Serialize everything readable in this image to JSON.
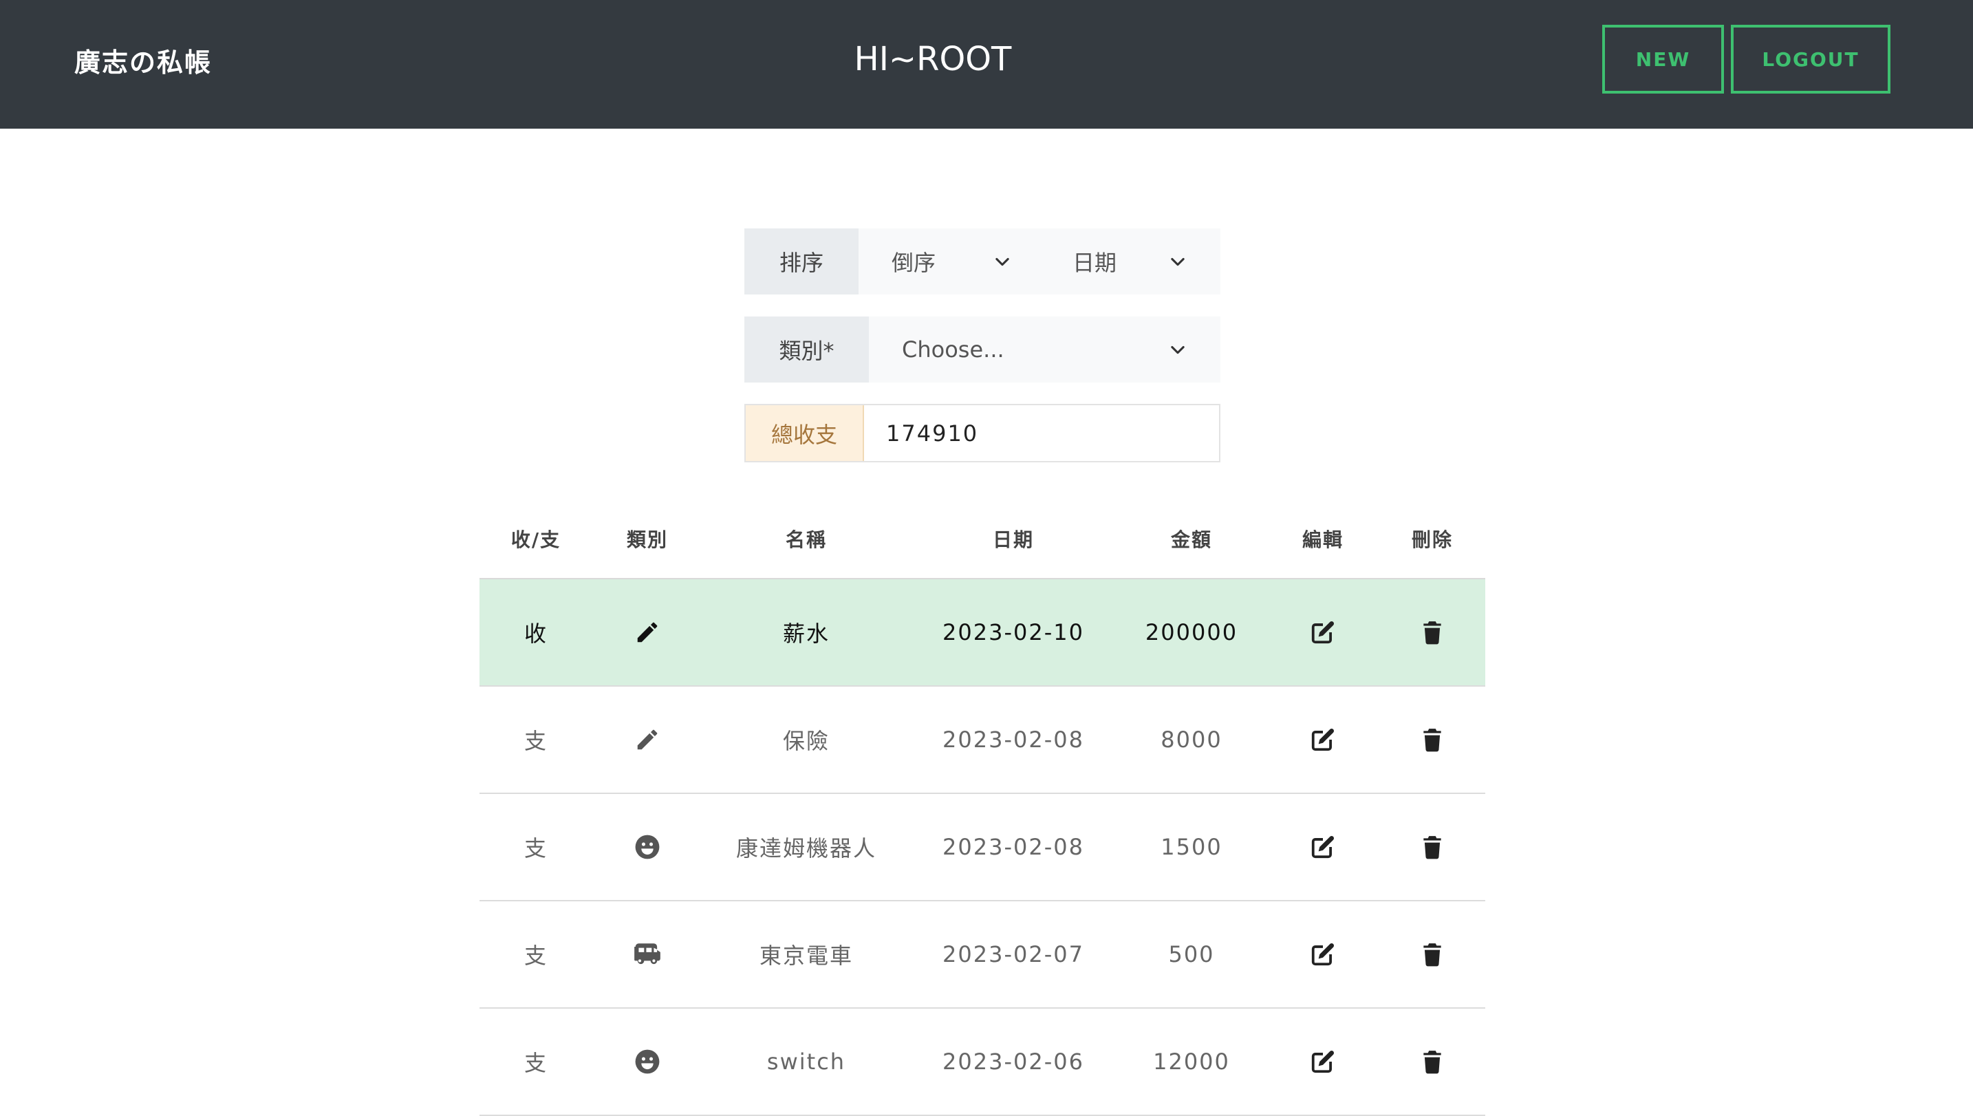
{
  "header": {
    "brand": "廣志の私帳",
    "greeting": "HI~ROOT",
    "new_label": "NEW",
    "logout_label": "LOGOUT",
    "accent_color": "#3ec070",
    "background_color": "#343a40"
  },
  "filters": {
    "sort_label": "排序",
    "sort_order": "倒序",
    "sort_field": "日期",
    "category_label": "類別*",
    "category_placeholder": "Choose...",
    "total_label": "總收支",
    "total_value": "174910"
  },
  "table": {
    "headers": [
      "收/支",
      "類別",
      "名稱",
      "日期",
      "金額",
      "編輯",
      "刪除"
    ],
    "rows": [
      {
        "type": "收",
        "category_icon": "pencil-icon",
        "name": "薪水",
        "date": "2023-02-10",
        "amount": "200000",
        "highlight": true
      },
      {
        "type": "支",
        "category_icon": "pencil-icon",
        "name": "保險",
        "date": "2023-02-08",
        "amount": "8000",
        "highlight": false
      },
      {
        "type": "支",
        "category_icon": "smile-icon",
        "name": "康達姆機器人",
        "date": "2023-02-08",
        "amount": "1500",
        "highlight": false
      },
      {
        "type": "支",
        "category_icon": "bus-icon",
        "name": "東京電車",
        "date": "2023-02-07",
        "amount": "500",
        "highlight": false
      },
      {
        "type": "支",
        "category_icon": "smile-icon",
        "name": "switch",
        "date": "2023-02-06",
        "amount": "12000",
        "highlight": false
      }
    ],
    "income_row_color": "#d8f0e0"
  }
}
